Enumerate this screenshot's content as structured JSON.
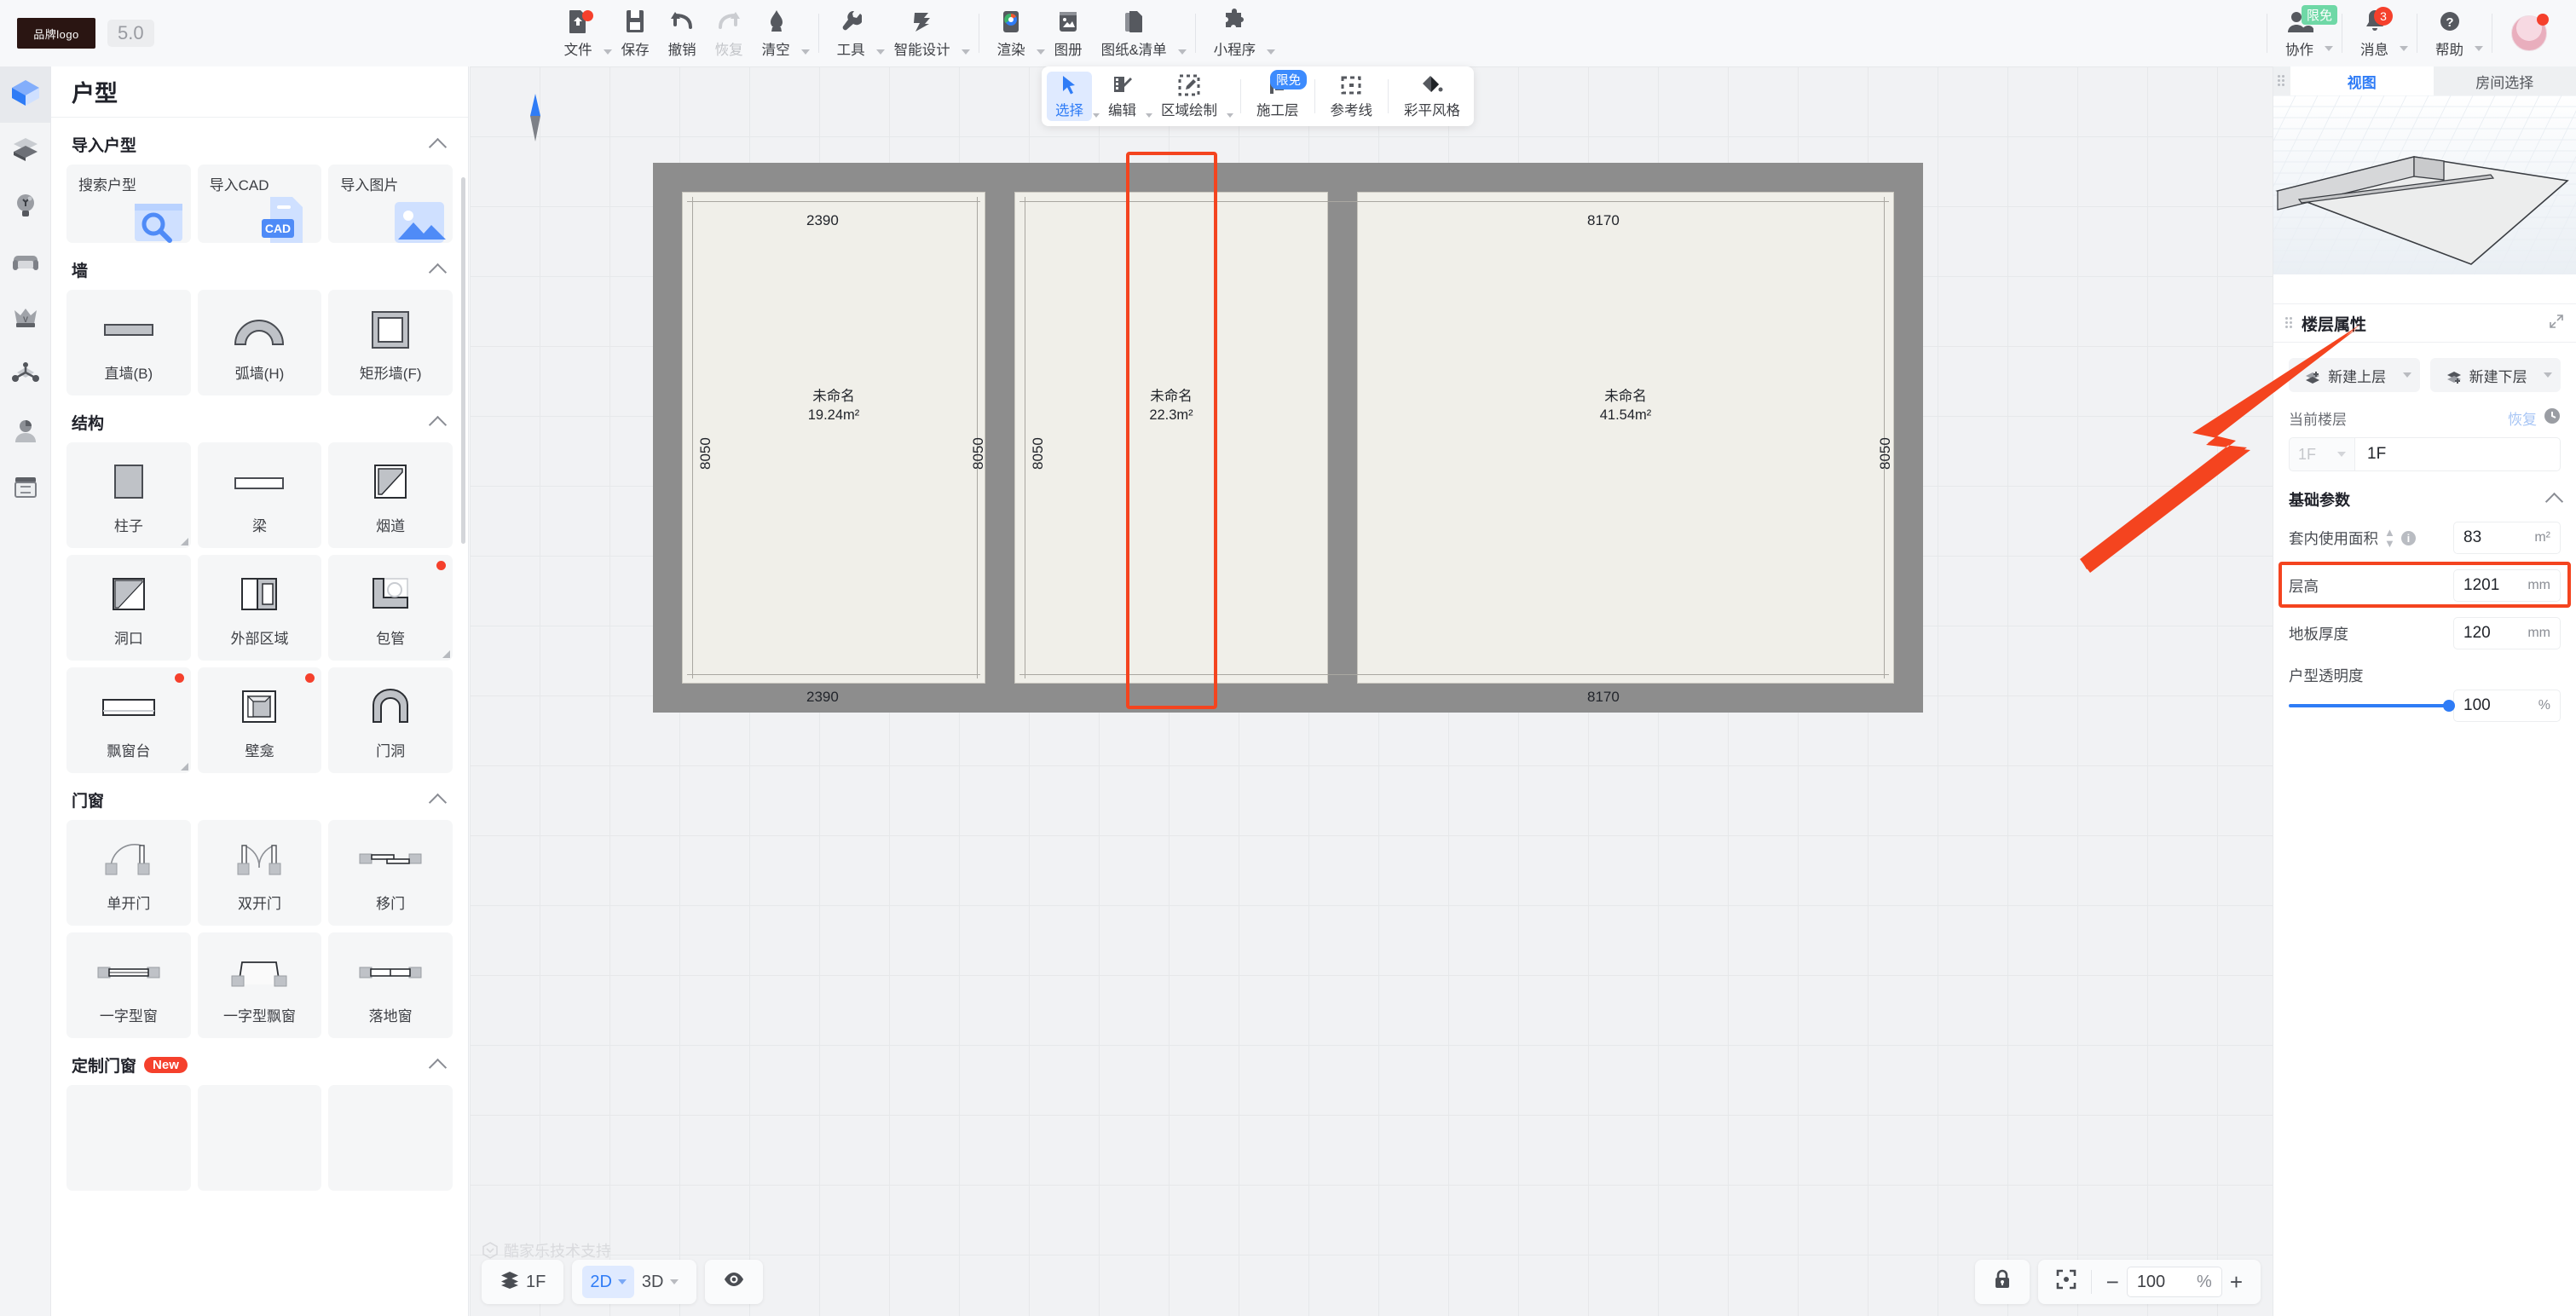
{
  "topbar": {
    "brand_logo": "品牌logo",
    "version": "5.0",
    "items": [
      {
        "name": "file",
        "label": "文件",
        "icon": "file-icon",
        "caret": true,
        "dot": true
      },
      {
        "name": "save",
        "label": "保存",
        "icon": "save-icon",
        "caret": false,
        "dot": false
      },
      {
        "name": "undo",
        "label": "撤销",
        "icon": "undo-icon",
        "caret": false,
        "dot": false
      },
      {
        "name": "redo",
        "label": "恢复",
        "icon": "redo-icon",
        "caret": false,
        "dot": false,
        "disabled": true
      },
      {
        "name": "clear",
        "label": "清空",
        "icon": "eraser-icon",
        "caret": true,
        "dot": false
      },
      {
        "name": "tools",
        "label": "工具",
        "icon": "wrench-icon",
        "caret": true,
        "dot": false
      },
      {
        "name": "smart-design",
        "label": "智能设计",
        "icon": "lightning-icon",
        "caret": true,
        "dot": false
      },
      {
        "name": "render",
        "label": "渲染",
        "icon": "camera-icon",
        "caret": true,
        "dot": false
      },
      {
        "name": "album",
        "label": "图册",
        "icon": "album-icon",
        "caret": false,
        "dot": false
      },
      {
        "name": "drawings-list",
        "label": "图纸&清单",
        "icon": "drawings-icon",
        "caret": true,
        "dot": false
      },
      {
        "name": "miniprogram",
        "label": "小程序",
        "icon": "puzzle-icon",
        "caret": true,
        "dot": false
      }
    ],
    "right_items": [
      {
        "name": "collaborate",
        "label": "协作",
        "icon": "users-icon",
        "badge_text": "限免",
        "caret": true
      },
      {
        "name": "messages",
        "label": "消息",
        "icon": "bell-icon",
        "count": "3",
        "caret": true
      },
      {
        "name": "help",
        "label": "帮助",
        "icon": "question-icon",
        "caret": true
      }
    ]
  },
  "subbar": {
    "items": [
      {
        "name": "select",
        "label": "选择",
        "icon": "cursor-icon",
        "caret": true,
        "active": true
      },
      {
        "name": "edit",
        "label": "编辑",
        "icon": "edit-icon",
        "caret": true,
        "active": false
      },
      {
        "name": "area-draw",
        "label": "区域绘制",
        "icon": "area-draw-icon",
        "caret": true,
        "active": false
      },
      {
        "name": "construction-layer",
        "label": "施工层",
        "icon": "corner-icon",
        "badge_text": "限免",
        "caret": false,
        "active": false
      },
      {
        "name": "reference-line",
        "label": "参考线",
        "icon": "dashed-square-icon",
        "caret": false,
        "active": false
      },
      {
        "name": "color-plan-style",
        "label": "彩平风格",
        "icon": "paint-bucket-icon",
        "caret": false,
        "active": false
      }
    ]
  },
  "rail": {
    "items": [
      {
        "name": "rail-floorplan",
        "icon": "cube-icon",
        "active": true
      },
      {
        "name": "rail-layers",
        "icon": "layers-icon",
        "active": false
      },
      {
        "name": "rail-lighting",
        "icon": "bulb-icon",
        "active": false
      },
      {
        "name": "rail-furniture",
        "icon": "sofa-icon",
        "active": false
      },
      {
        "name": "rail-premium",
        "icon": "crown-icon",
        "active": false
      },
      {
        "name": "rail-model",
        "icon": "model-icon",
        "active": false
      },
      {
        "name": "rail-account",
        "icon": "person-icon",
        "active": false
      },
      {
        "name": "rail-cabinet",
        "icon": "cabinet-icon",
        "active": false
      }
    ]
  },
  "left_panel": {
    "title": "户型",
    "sections": [
      {
        "name": "import-floorplan",
        "title": "导入户型",
        "layout": "banner",
        "items": [
          {
            "name": "search-floorplan",
            "label": "搜索户型",
            "thumb": "search-thumb"
          },
          {
            "name": "import-cad",
            "label": "导入CAD",
            "thumb": "cad-thumb"
          },
          {
            "name": "import-image",
            "label": "导入图片",
            "thumb": "image-thumb"
          }
        ]
      },
      {
        "name": "wall",
        "title": "墙",
        "layout": "tile",
        "items": [
          {
            "name": "straight-wall",
            "label": "直墙(B)",
            "icon": "straight-wall-icon"
          },
          {
            "name": "arc-wall",
            "label": "弧墙(H)",
            "icon": "arc-wall-icon"
          },
          {
            "name": "rect-wall",
            "label": "矩形墙(F)",
            "icon": "rect-wall-icon"
          }
        ]
      },
      {
        "name": "structure",
        "title": "结构",
        "layout": "tile",
        "items": [
          {
            "name": "column",
            "label": "柱子",
            "icon": "column-icon",
            "resize": true
          },
          {
            "name": "beam",
            "label": "梁",
            "icon": "beam-icon"
          },
          {
            "name": "flue",
            "label": "烟道",
            "icon": "flue-icon"
          },
          {
            "name": "opening",
            "label": "洞口",
            "icon": "opening-icon"
          },
          {
            "name": "external-area",
            "label": "外部区域",
            "icon": "external-area-icon"
          },
          {
            "name": "pipe-wrap",
            "label": "包管",
            "icon": "pipe-wrap-icon",
            "dot": true,
            "resize": true
          },
          {
            "name": "bay-window-sill",
            "label": "飘窗台",
            "icon": "bay-sill-icon",
            "dot": true,
            "resize": true
          },
          {
            "name": "niche",
            "label": "壁龛",
            "icon": "niche-icon",
            "dot": true
          },
          {
            "name": "door-opening",
            "label": "门洞",
            "icon": "door-opening-icon"
          }
        ]
      },
      {
        "name": "doors-windows",
        "title": "门窗",
        "layout": "tile",
        "items": [
          {
            "name": "single-door",
            "label": "单开门",
            "icon": "single-door-icon"
          },
          {
            "name": "double-door",
            "label": "双开门",
            "icon": "double-door-icon"
          },
          {
            "name": "sliding-door",
            "label": "移门",
            "icon": "sliding-door-icon"
          },
          {
            "name": "flat-window",
            "label": "一字型窗",
            "icon": "flat-window-icon"
          },
          {
            "name": "flat-bay-window",
            "label": "一字型飘窗",
            "icon": "flat-bay-window-icon"
          },
          {
            "name": "french-window",
            "label": "落地窗",
            "icon": "french-window-icon"
          }
        ]
      },
      {
        "name": "custom-doors-windows",
        "title": "定制门窗",
        "badge": "New",
        "layout": "tile",
        "items": []
      }
    ]
  },
  "canvas": {
    "watermark": "酷家乐技术支持",
    "compass": "north-arrow-icon",
    "rooms": [
      {
        "name": "room-1",
        "label": "未命名",
        "area": "19.24m²",
        "top_dim": "2390",
        "bottom_dim": "2390",
        "left_dim": "8050",
        "right_dim": "8050"
      },
      {
        "name": "room-2",
        "label": "未命名",
        "area": "22.3m²",
        "left_dim": "8050"
      },
      {
        "name": "room-3",
        "label": "未命名",
        "area": "41.54m²",
        "top_dim": "8170",
        "bottom_dim": "8170",
        "right_dim": "8050"
      }
    ],
    "selection": "selected-wall-highlight",
    "bottom_left": {
      "floor_label": "1F",
      "floor_icon": "layers-icon",
      "view_2d": "2D",
      "view_3d": "3D",
      "eye_icon": "eye-icon"
    },
    "bottom_right": {
      "lock_icon": "lock-icon",
      "fit_icon": "fit-to-screen-icon",
      "minus": "−",
      "zoom_value": "100",
      "zoom_unit": "%",
      "plus": "+"
    }
  },
  "right_panel": {
    "tabs": [
      {
        "name": "tab-view",
        "label": "视图",
        "active": true
      },
      {
        "name": "tab-room-select",
        "label": "房间选择",
        "active": false
      }
    ],
    "props": {
      "title": "楼层属性",
      "expand_icon": "expand-icon",
      "new_upper_floor": "新建上层",
      "new_lower_floor": "新建下层",
      "current_floor_label": "当前楼层",
      "restore_label": "恢复",
      "history_icon": "history-icon",
      "floor_select_value": "1F",
      "floor_name_value": "1F",
      "basic_params_title": "基础参数",
      "rows": [
        {
          "name": "inner-usable-area",
          "label": "套内使用面积",
          "value": "83",
          "unit": "m²",
          "info": true,
          "spinner": true,
          "highlight": false
        },
        {
          "name": "floor-height",
          "label": "层高",
          "value": "1201",
          "unit": "mm",
          "info": false,
          "spinner": false,
          "highlight": true
        },
        {
          "name": "floor-thickness",
          "label": "地板厚度",
          "value": "120",
          "unit": "mm",
          "info": false,
          "spinner": false,
          "highlight": false
        }
      ],
      "transparency_label": "户型透明度",
      "transparency_value": "100",
      "transparency_unit": "%"
    }
  },
  "colors": {
    "accent": "#2f7cf6",
    "highlight": "#f4441f",
    "wall": "#8d8d8d",
    "room_fill": "#f0efe9",
    "badge_green": "#6fd8a6",
    "badge_red": "#f5402c"
  }
}
